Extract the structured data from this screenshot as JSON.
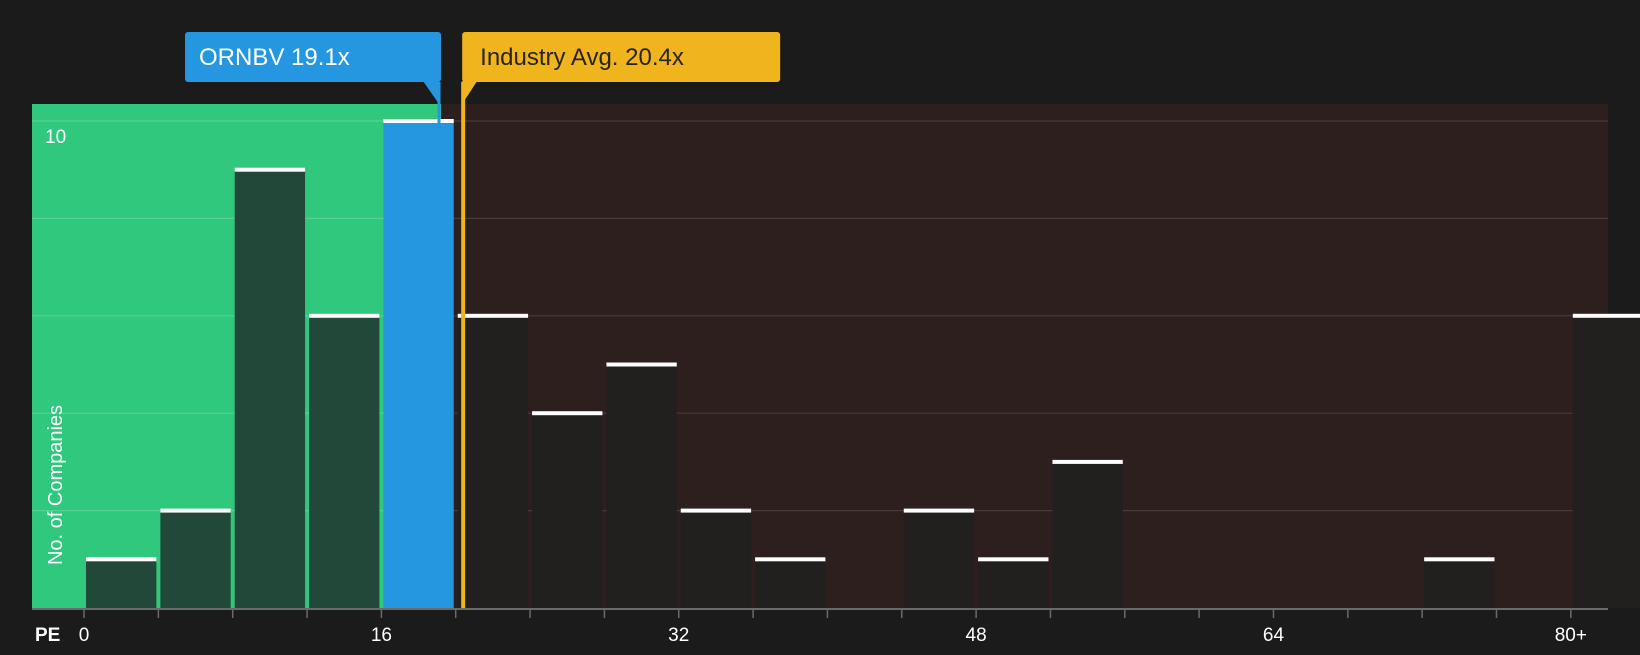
{
  "colors": {
    "background": "#1b1b1b",
    "below_zone": "#2fc87d",
    "above_zone": "#2e1f1f",
    "company": "#2596e0",
    "industry": "#f0b41c",
    "bar_in_green": "#22483a",
    "bar_in_red": "#221f1f",
    "cap": "#ffffff",
    "grid": "#4a3a3a",
    "tick_text": "#ffffff"
  },
  "company_callout": {
    "label": "ORNBV 19.1x",
    "value": 19.1
  },
  "industry_callout": {
    "label": "Industry Avg. 20.4x",
    "value": 20.4
  },
  "chart_data": {
    "type": "bar",
    "xlabel": "PE",
    "ylabel": "No. of Companies",
    "x_ticks": [
      "0",
      "16",
      "32",
      "48",
      "64",
      "80+"
    ],
    "x_tick_values": [
      0,
      16,
      32,
      48,
      64,
      80
    ],
    "y_ticks": [
      "10"
    ],
    "y_tick_values": [
      10
    ],
    "xlim": [
      -2.8,
      82.0
    ],
    "ylim": [
      0,
      10.4
    ],
    "grid": true,
    "bin_width": 4,
    "bins": [
      {
        "start": 0,
        "count": 1
      },
      {
        "start": 4,
        "count": 2
      },
      {
        "start": 8,
        "count": 9
      },
      {
        "start": 12,
        "count": 6
      },
      {
        "start": 16,
        "count": 10,
        "highlight": true
      },
      {
        "start": 20,
        "count": 6
      },
      {
        "start": 24,
        "count": 4
      },
      {
        "start": 28,
        "count": 5
      },
      {
        "start": 32,
        "count": 2
      },
      {
        "start": 36,
        "count": 1
      },
      {
        "start": 40,
        "count": 0
      },
      {
        "start": 44,
        "count": 2
      },
      {
        "start": 48,
        "count": 1
      },
      {
        "start": 52,
        "count": 3
      },
      {
        "start": 56,
        "count": 0
      },
      {
        "start": 60,
        "count": 0
      },
      {
        "start": 64,
        "count": 0
      },
      {
        "start": 68,
        "count": 0
      },
      {
        "start": 72,
        "count": 1
      },
      {
        "start": 76,
        "count": 0
      },
      {
        "start": 80,
        "count": 6
      }
    ]
  }
}
